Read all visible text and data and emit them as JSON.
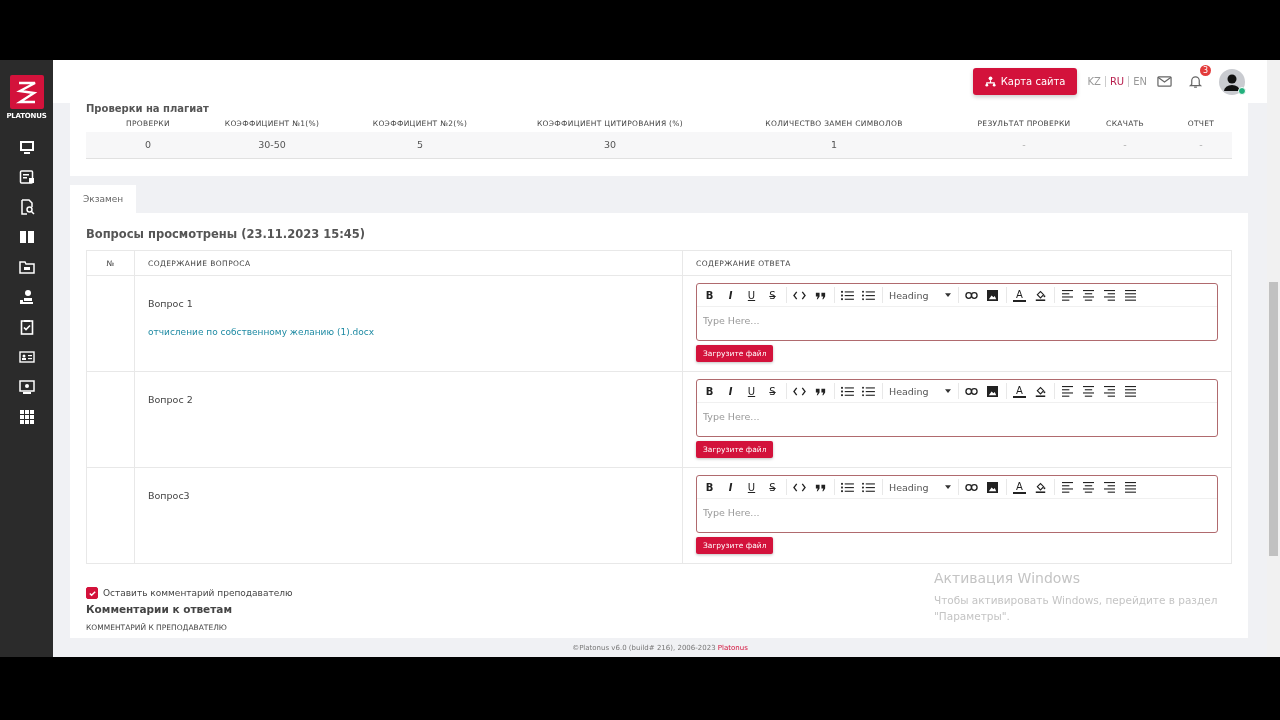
{
  "sidebar": {
    "logo_text": "PLATONUS"
  },
  "header": {
    "sitemap_button": "Карта сайта",
    "languages": [
      {
        "label": "KZ",
        "selected": false
      },
      {
        "label": "RU",
        "selected": true
      },
      {
        "label": "EN",
        "selected": false
      }
    ],
    "notifications": "3"
  },
  "plagiarism": {
    "title": "Проверки на плагиат",
    "columns": [
      "ПРОВЕРКИ",
      "КОЭФФИЦИЕНТ №1(%)",
      "КОЭФФИЦИЕНТ №2(%)",
      "КОЭФФИЦИЕНТ ЦИТИРОВАНИЯ (%)",
      "КОЛИЧЕСТВО ЗАМЕН СИМВОЛОВ",
      "РЕЗУЛЬТАТ ПРОВЕРКИ",
      "СКАЧАТЬ",
      "ОТЧЕТ"
    ],
    "row": [
      "0",
      "30-50",
      "5",
      "30",
      "1",
      "-",
      "-",
      "-"
    ]
  },
  "tabs": [
    {
      "label": "Экзамен",
      "selected": true
    }
  ],
  "questions": {
    "title": "Вопросы просмотрены (23.11.2023 15:45)",
    "columns": [
      "№",
      "СОДЕРЖАНИЕ ВОПРОСА",
      "СОДЕРЖАНИЕ ОТВЕТА"
    ],
    "rows": [
      {
        "question": "Вопрос 1",
        "attachment": "отчисление по собственному желанию (1).docx",
        "editor": {
          "marks": [
            "B",
            "I",
            "U",
            "S"
          ],
          "color_letter": "A",
          "heading": "Heading",
          "placeholder": "Type Here..."
        },
        "upload_button": "Загрузите файл"
      },
      {
        "question": "Вопрос 2",
        "editor": {
          "marks": [
            "B",
            "I",
            "U",
            "S"
          ],
          "color_letter": "A",
          "heading": "Heading",
          "placeholder": "Type Here..."
        },
        "upload_button": "Загрузите файл"
      },
      {
        "question": "Вопрос3",
        "editor": {
          "marks": [
            "B",
            "I",
            "U",
            "S"
          ],
          "color_letter": "A",
          "heading": "Heading",
          "placeholder": "Type Here..."
        },
        "upload_button": "Загрузите файл"
      }
    ]
  },
  "comment_checkbox": {
    "label": "Оставить комментарий преподавателю",
    "checked": true
  },
  "comments": {
    "title": "Комментарии к ответам",
    "label": "КОММЕНТАРИЙ К ПРЕПОДАВАТЕЛЮ"
  },
  "footer": {
    "text": "©Platonus v6.0 (build# 216), 2006-2023",
    "link": "Platonus"
  },
  "os_notice": {
    "title": "Активация Windows",
    "text": "Чтобы активировать Windows, перейдите в раздел \"Параметры\"."
  }
}
